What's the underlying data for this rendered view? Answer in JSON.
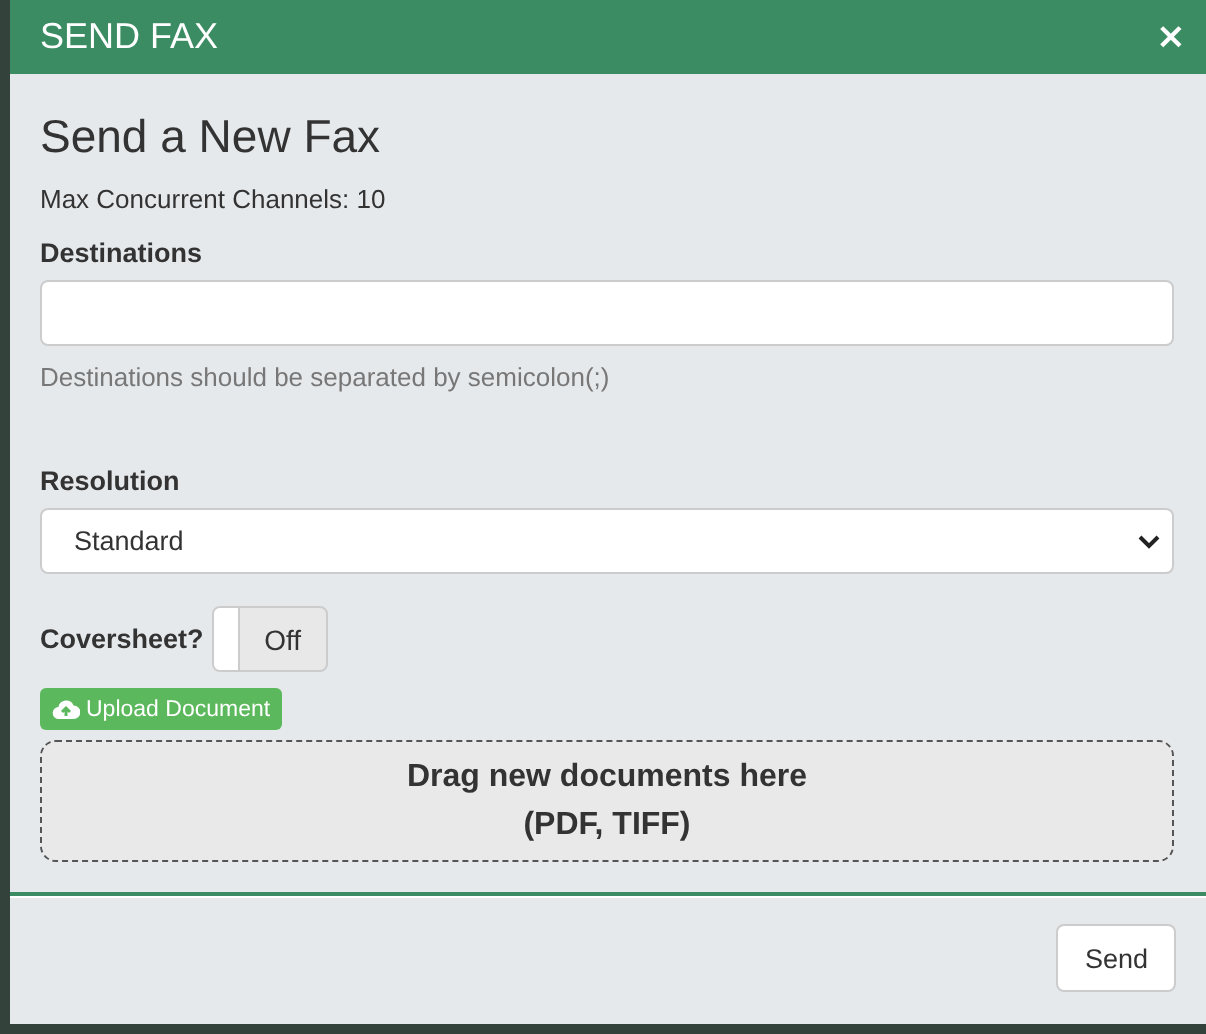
{
  "window": {
    "title": "SEND FAX",
    "close": "×"
  },
  "heading": "Send a New Fax",
  "info": "Max Concurrent Channels: 10",
  "destinations": {
    "label": "Destinations",
    "help": "Destinations should be separated by semicolon(;)"
  },
  "resolution": {
    "label": "Resolution",
    "value": "Standard"
  },
  "coversheet": {
    "label": "Coversheet?",
    "on": false,
    "state_text": "Off"
  },
  "upload_button": "Upload Document",
  "dropzone": [
    "Drag new documents here",
    "(PDF, TIFF)"
  ],
  "buttons": [
    "Send"
  ]
}
